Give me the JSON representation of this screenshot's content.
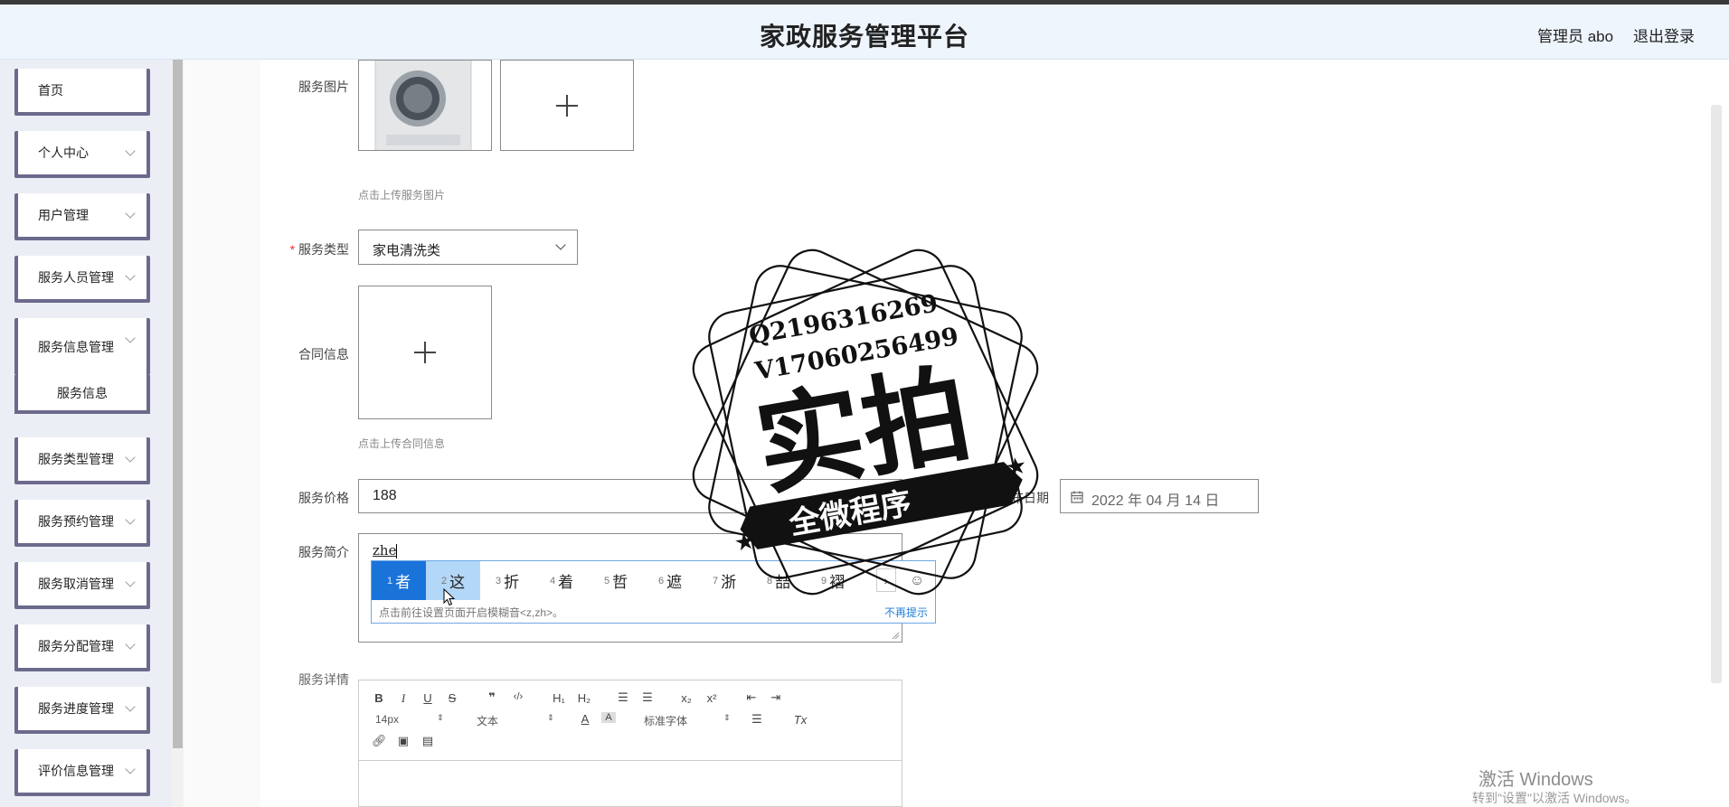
{
  "header": {
    "title": "家政服务管理平台",
    "user": "管理员 abo",
    "logout": "退出登录"
  },
  "sidebar": {
    "home": "首页",
    "personal": "个人中心",
    "users": "用户管理",
    "staff": "服务人员管理",
    "info": "服务信息管理",
    "info_sub": "服务信息",
    "types": "服务类型管理",
    "booking": "服务预约管理",
    "cancel": "服务取消管理",
    "assign": "服务分配管理",
    "progress": "服务进度管理",
    "review": "评价信息管理"
  },
  "form": {
    "image_label": "服务图片",
    "image_hint": "点击上传服务图片",
    "type_label": "服务类型",
    "type_value": "家电清洗类",
    "contract_label": "合同信息",
    "contract_hint": "点击上传合同信息",
    "price_label": "服务价格",
    "price_value": "188",
    "date_label": "发布日期",
    "date_value": "2022 年 04 月 14 日",
    "intro_label": "服务简介",
    "intro_value": "zhe",
    "detail_label": "服务详情"
  },
  "ime": {
    "candidates": [
      {
        "n": "1",
        "c": "者"
      },
      {
        "n": "2",
        "c": "这"
      },
      {
        "n": "3",
        "c": "折"
      },
      {
        "n": "4",
        "c": "着"
      },
      {
        "n": "5",
        "c": "哲"
      },
      {
        "n": "6",
        "c": "遮"
      },
      {
        "n": "7",
        "c": "浙"
      },
      {
        "n": "8",
        "c": "喆"
      },
      {
        "n": "9",
        "c": "褶"
      }
    ],
    "tip": "点击前往设置页面开启模糊音<z,zh>。",
    "dismiss": "不再提示",
    "colors": {
      "selected": "#1a73d9",
      "hover": "#b3d7f7"
    }
  },
  "editor": {
    "bold": "B",
    "italic": "I",
    "underline": "U",
    "strike": "S",
    "quote": "❞",
    "code": "‹/›",
    "h1": "H₁",
    "h2": "H₂",
    "ol": "☰",
    "ul": "☰",
    "sub": "x₂",
    "sup": "x²",
    "outdent": "⇤",
    "indent": "⇥",
    "size": "14px",
    "format": "文本",
    "font": "标准字体",
    "clear": "Tx"
  },
  "stamp": {
    "contact1": "Q2196316269",
    "contact2": "V17060256499",
    "main": "实拍",
    "banner": "全微程序"
  },
  "os_watermark": {
    "line1": "激活 Windows",
    "line2": "转到\"设置\"以激活 Windows。"
  }
}
